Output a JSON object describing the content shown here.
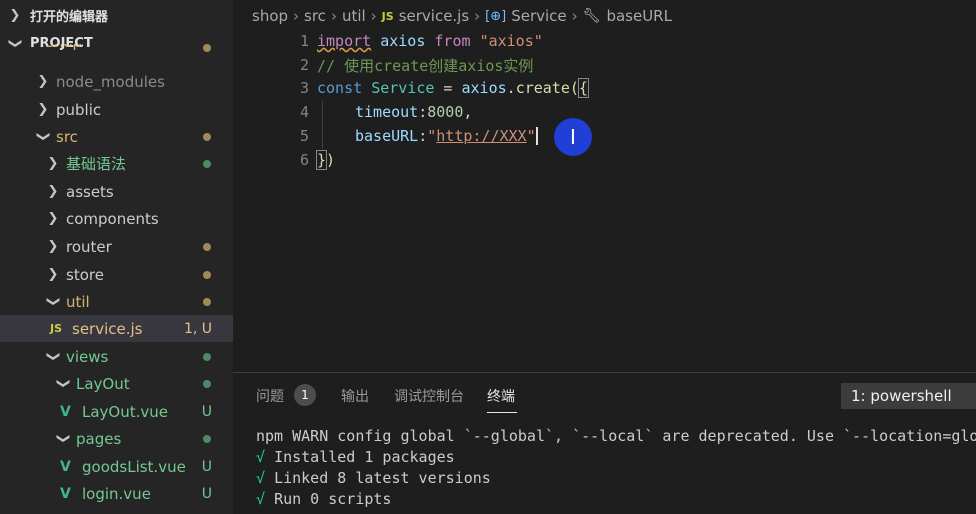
{
  "sidebar": {
    "open_editors_label": "打开的编辑器",
    "project_label": "PROJECT",
    "partial_label": "shop",
    "items": [
      {
        "label": "node_modules"
      },
      {
        "label": "public"
      },
      {
        "label": "src"
      },
      {
        "label": "基础语法"
      },
      {
        "label": "assets"
      },
      {
        "label": "components"
      },
      {
        "label": "router"
      },
      {
        "label": "store"
      },
      {
        "label": "util"
      },
      {
        "label": "service.js",
        "badge": "1, U",
        "icon": "JS"
      },
      {
        "label": "views"
      },
      {
        "label": "LayOut"
      },
      {
        "label": "LayOut.vue",
        "badge": "U",
        "icon": "V"
      },
      {
        "label": "pages"
      },
      {
        "label": "goodsList.vue",
        "badge": "U",
        "icon": "V"
      },
      {
        "label": "login.vue",
        "badge": "U",
        "icon": "V"
      }
    ]
  },
  "breadcrumb": {
    "parts": [
      "shop",
      "src",
      "util"
    ],
    "file_icon": "JS",
    "file": "service.js",
    "symbol1": "Service",
    "symbol2": "baseURL"
  },
  "editor": {
    "lines": [
      {
        "n": "1"
      },
      {
        "n": "2"
      },
      {
        "n": "3"
      },
      {
        "n": "4"
      },
      {
        "n": "5"
      },
      {
        "n": "6"
      }
    ],
    "tokens": {
      "import": "import",
      "axios": "axios",
      "from": "from",
      "axios_str": "\"axios\"",
      "comment": "// 使用create创建axios实例",
      "const": "const",
      "service": "Service",
      "eq": " = ",
      "axios2": "axios",
      "dot": ".",
      "create": "create",
      "paren": "(",
      "brace": "{",
      "timeout": "timeout",
      "colon": ":",
      "timeout_val": "8000",
      "comma": ",",
      "baseURL": "baseURL",
      "colon2": ":",
      "url_q1": "\"",
      "url": "http://XXX",
      "url_q2": "\"",
      "close_brace": "}",
      "close_paren": ")"
    },
    "mouse_icon": "I"
  },
  "panel": {
    "tabs": [
      "问题",
      "输出",
      "调试控制台",
      "终端"
    ],
    "problem_count": "1",
    "terminal_select": "1: powershell",
    "terminal_lines": [
      "npm WARN config global `--global`, `--local` are deprecated. Use `--location=glo",
      "Installed 1 packages",
      "Linked 8 latest versions",
      "Run 0 scripts"
    ],
    "check_mark": "√"
  }
}
